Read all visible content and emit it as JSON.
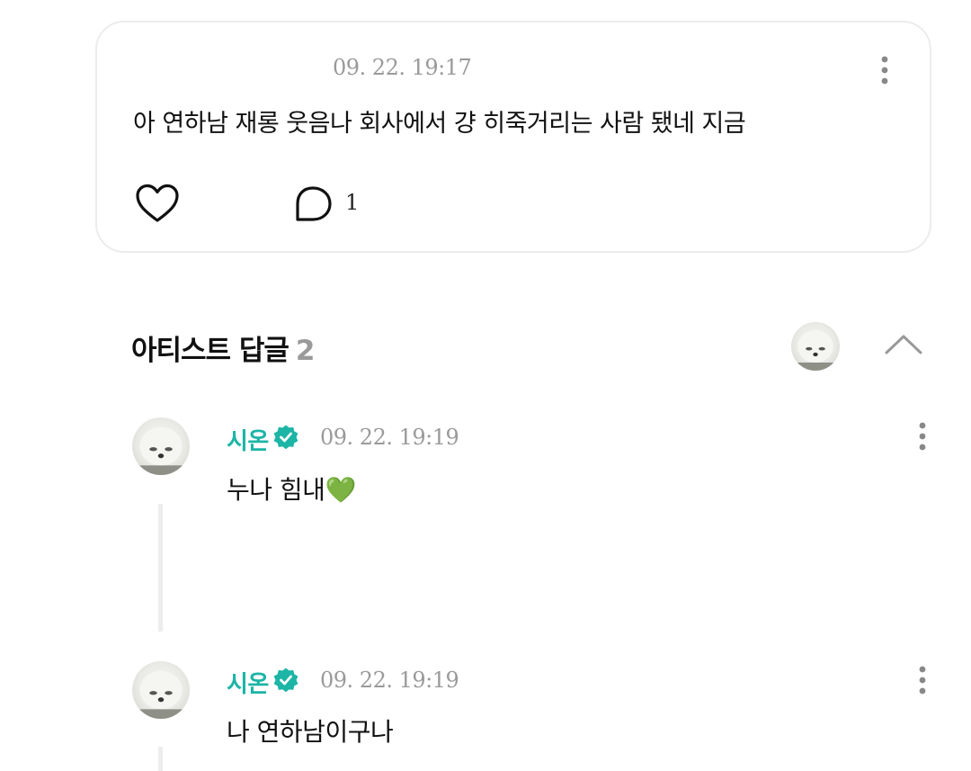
{
  "post": {
    "timestamp": "09. 22. 19:17",
    "text": "아 연하남 재롱 웃음나 회사에서 걍 히죽거리는 사람 됐네 지금",
    "comment_count": "1"
  },
  "artist_replies": {
    "title": "아티스트 답글",
    "count": "2"
  },
  "replies": [
    {
      "author": "시온",
      "timestamp": "09. 22. 19:19",
      "text": "누나 힘내💚"
    },
    {
      "author": "시온",
      "timestamp": "09. 22. 19:19",
      "text": "나 연하남이구나"
    }
  ],
  "colors": {
    "author": "#1db5a6",
    "verified_badge": "#1db5a6",
    "muted_text": "#9a9a9a",
    "card_border": "#ececec"
  },
  "icons": {
    "like": "heart-outline-icon",
    "comment": "speech-bubble-icon",
    "more": "vertical-dots-icon",
    "collapse": "chevron-up-icon",
    "verified": "verified-badge-icon"
  }
}
